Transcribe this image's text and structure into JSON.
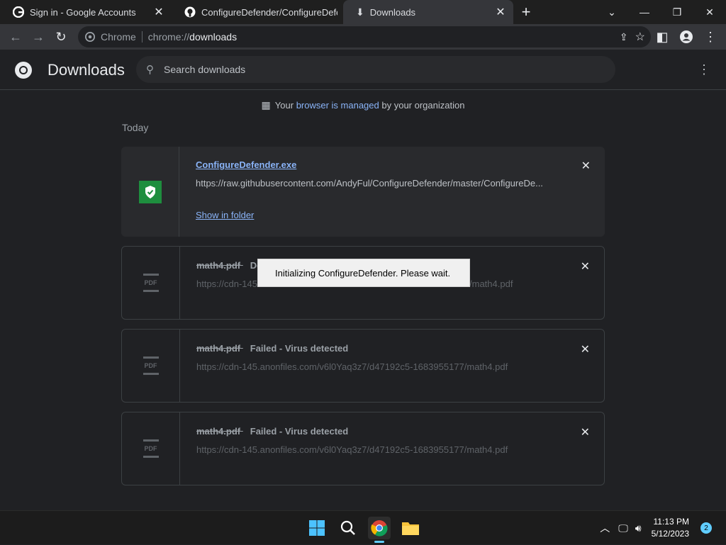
{
  "tabs": [
    {
      "title": "Sign in - Google Accounts",
      "icon": "google-icon"
    },
    {
      "title": "ConfigureDefender/ConfigureDefe",
      "icon": "github-icon"
    },
    {
      "title": "Downloads",
      "icon": "download-icon",
      "active": true
    }
  ],
  "omnibox": {
    "chip": "Chrome",
    "url_prefix": "chrome://",
    "url_path": "downloads"
  },
  "page": {
    "title": "Downloads",
    "search_placeholder": "Search downloads",
    "managed_prefix": "Your",
    "managed_link": "browser is managed",
    "managed_suffix": "by your organization",
    "section": "Today"
  },
  "downloads": [
    {
      "filename": "ConfigureDefender.exe",
      "url": "https://raw.githubusercontent.com/AndyFul/ConfigureDefender/master/ConfigureDe...",
      "action": "Show in folder"
    },
    {
      "filename": "math4.pdf",
      "status": "De",
      "url_start": "https://cdn-145",
      "url_end": "/math4.pdf",
      "icon_label": "PDF"
    },
    {
      "filename": "math4.pdf",
      "status": "Failed - Virus detected",
      "url": "https://cdn-145.anonfiles.com/v6l0Yaq3z7/d47192c5-1683955177/math4.pdf",
      "icon_label": "PDF"
    },
    {
      "filename": "math4.pdf",
      "status": "Failed - Virus detected",
      "url": "https://cdn-145.anonfiles.com/v6l0Yaq3z7/d47192c5-1683955177/math4.pdf",
      "icon_label": "PDF"
    }
  ],
  "popup": {
    "message": "Initializing ConfigureDefender. Please wait."
  },
  "taskbar": {
    "time": "11:13 PM",
    "date": "5/12/2023",
    "notification_count": "2"
  },
  "colors": {
    "accent": "#8ab4f8",
    "shield_green": "#1e8e3e",
    "taskbar_accent": "#60cdff"
  }
}
